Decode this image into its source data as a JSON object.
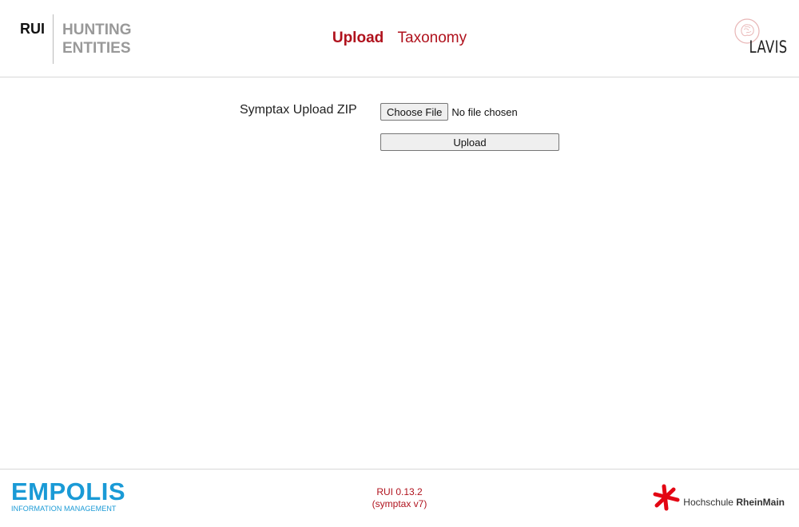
{
  "header": {
    "brand_short": "RUI",
    "brand_line1": "HUNTING",
    "brand_line2": "ENTITIES",
    "nav": [
      {
        "label": "Upload",
        "active": true
      },
      {
        "label": "Taxonomy",
        "active": false
      }
    ],
    "partner_logo_text": "LAVIS"
  },
  "upload_form": {
    "label": "Symptax Upload ZIP",
    "choose_file_label": "Choose File",
    "file_status": "No file chosen",
    "submit_label": "Upload"
  },
  "footer": {
    "empolis_name": "EMPOLIS",
    "empolis_tagline": "INFORMATION MANAGEMENT",
    "version_line1": "RUI 0.13.2",
    "version_line2": "(symptax v7)",
    "university_prefix": "Hochschule",
    "university_name": "RheinMain"
  },
  "colors": {
    "accent_red": "#b0121d",
    "empolis_blue": "#1a9ad6",
    "muted_gray": "#999999"
  },
  "icons": {
    "lavis_logo": "brain-circle-icon",
    "university_logo": "asterisk-icon"
  }
}
